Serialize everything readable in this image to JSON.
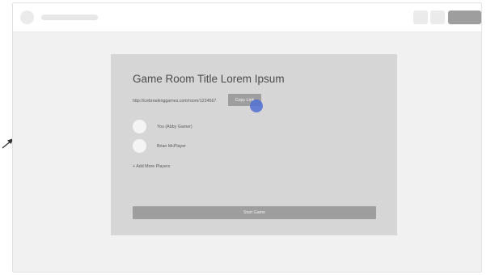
{
  "room": {
    "title": "Game Room Title Lorem Ipsum",
    "url": "http://icebreakinggames.com/room/1234567",
    "copy_label": "Copy Link"
  },
  "players": [
    {
      "name": "You (Abby Gamer)"
    },
    {
      "name": "Brian McPlayer"
    }
  ],
  "add_players_label": "+ Add More Players",
  "start_label": "Start Game",
  "colors": {
    "cursor": "#506ed2",
    "button": "#9e9e9e",
    "card": "#d6d6d6"
  }
}
